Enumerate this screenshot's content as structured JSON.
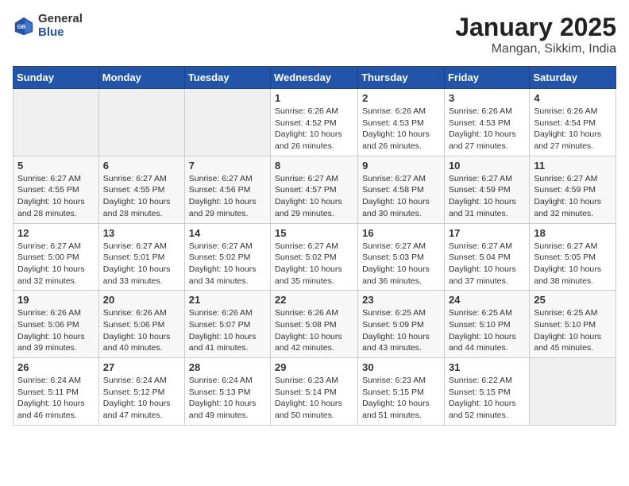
{
  "header": {
    "logo_general": "General",
    "logo_blue": "Blue",
    "month": "January 2025",
    "location": "Mangan, Sikkim, India"
  },
  "days_of_week": [
    "Sunday",
    "Monday",
    "Tuesday",
    "Wednesday",
    "Thursday",
    "Friday",
    "Saturday"
  ],
  "weeks": [
    [
      {
        "day": "",
        "info": ""
      },
      {
        "day": "",
        "info": ""
      },
      {
        "day": "",
        "info": ""
      },
      {
        "day": "1",
        "sunrise": "6:26 AM",
        "sunset": "4:52 PM",
        "daylight": "10 hours and 26 minutes."
      },
      {
        "day": "2",
        "sunrise": "6:26 AM",
        "sunset": "4:53 PM",
        "daylight": "10 hours and 26 minutes."
      },
      {
        "day": "3",
        "sunrise": "6:26 AM",
        "sunset": "4:53 PM",
        "daylight": "10 hours and 27 minutes."
      },
      {
        "day": "4",
        "sunrise": "6:26 AM",
        "sunset": "4:54 PM",
        "daylight": "10 hours and 27 minutes."
      }
    ],
    [
      {
        "day": "5",
        "sunrise": "6:27 AM",
        "sunset": "4:55 PM",
        "daylight": "10 hours and 28 minutes."
      },
      {
        "day": "6",
        "sunrise": "6:27 AM",
        "sunset": "4:55 PM",
        "daylight": "10 hours and 28 minutes."
      },
      {
        "day": "7",
        "sunrise": "6:27 AM",
        "sunset": "4:56 PM",
        "daylight": "10 hours and 29 minutes."
      },
      {
        "day": "8",
        "sunrise": "6:27 AM",
        "sunset": "4:57 PM",
        "daylight": "10 hours and 29 minutes."
      },
      {
        "day": "9",
        "sunrise": "6:27 AM",
        "sunset": "4:58 PM",
        "daylight": "10 hours and 30 minutes."
      },
      {
        "day": "10",
        "sunrise": "6:27 AM",
        "sunset": "4:59 PM",
        "daylight": "10 hours and 31 minutes."
      },
      {
        "day": "11",
        "sunrise": "6:27 AM",
        "sunset": "4:59 PM",
        "daylight": "10 hours and 32 minutes."
      }
    ],
    [
      {
        "day": "12",
        "sunrise": "6:27 AM",
        "sunset": "5:00 PM",
        "daylight": "10 hours and 32 minutes."
      },
      {
        "day": "13",
        "sunrise": "6:27 AM",
        "sunset": "5:01 PM",
        "daylight": "10 hours and 33 minutes."
      },
      {
        "day": "14",
        "sunrise": "6:27 AM",
        "sunset": "5:02 PM",
        "daylight": "10 hours and 34 minutes."
      },
      {
        "day": "15",
        "sunrise": "6:27 AM",
        "sunset": "5:02 PM",
        "daylight": "10 hours and 35 minutes."
      },
      {
        "day": "16",
        "sunrise": "6:27 AM",
        "sunset": "5:03 PM",
        "daylight": "10 hours and 36 minutes."
      },
      {
        "day": "17",
        "sunrise": "6:27 AM",
        "sunset": "5:04 PM",
        "daylight": "10 hours and 37 minutes."
      },
      {
        "day": "18",
        "sunrise": "6:27 AM",
        "sunset": "5:05 PM",
        "daylight": "10 hours and 38 minutes."
      }
    ],
    [
      {
        "day": "19",
        "sunrise": "6:26 AM",
        "sunset": "5:06 PM",
        "daylight": "10 hours and 39 minutes."
      },
      {
        "day": "20",
        "sunrise": "6:26 AM",
        "sunset": "5:06 PM",
        "daylight": "10 hours and 40 minutes."
      },
      {
        "day": "21",
        "sunrise": "6:26 AM",
        "sunset": "5:07 PM",
        "daylight": "10 hours and 41 minutes."
      },
      {
        "day": "22",
        "sunrise": "6:26 AM",
        "sunset": "5:08 PM",
        "daylight": "10 hours and 42 minutes."
      },
      {
        "day": "23",
        "sunrise": "6:25 AM",
        "sunset": "5:09 PM",
        "daylight": "10 hours and 43 minutes."
      },
      {
        "day": "24",
        "sunrise": "6:25 AM",
        "sunset": "5:10 PM",
        "daylight": "10 hours and 44 minutes."
      },
      {
        "day": "25",
        "sunrise": "6:25 AM",
        "sunset": "5:10 PM",
        "daylight": "10 hours and 45 minutes."
      }
    ],
    [
      {
        "day": "26",
        "sunrise": "6:24 AM",
        "sunset": "5:11 PM",
        "daylight": "10 hours and 46 minutes."
      },
      {
        "day": "27",
        "sunrise": "6:24 AM",
        "sunset": "5:12 PM",
        "daylight": "10 hours and 47 minutes."
      },
      {
        "day": "28",
        "sunrise": "6:24 AM",
        "sunset": "5:13 PM",
        "daylight": "10 hours and 49 minutes."
      },
      {
        "day": "29",
        "sunrise": "6:23 AM",
        "sunset": "5:14 PM",
        "daylight": "10 hours and 50 minutes."
      },
      {
        "day": "30",
        "sunrise": "6:23 AM",
        "sunset": "5:15 PM",
        "daylight": "10 hours and 51 minutes."
      },
      {
        "day": "31",
        "sunrise": "6:22 AM",
        "sunset": "5:15 PM",
        "daylight": "10 hours and 52 minutes."
      },
      {
        "day": "",
        "info": ""
      }
    ]
  ],
  "labels": {
    "sunrise_prefix": "Sunrise: ",
    "sunset_prefix": "Sunset: ",
    "daylight_prefix": "Daylight: "
  }
}
